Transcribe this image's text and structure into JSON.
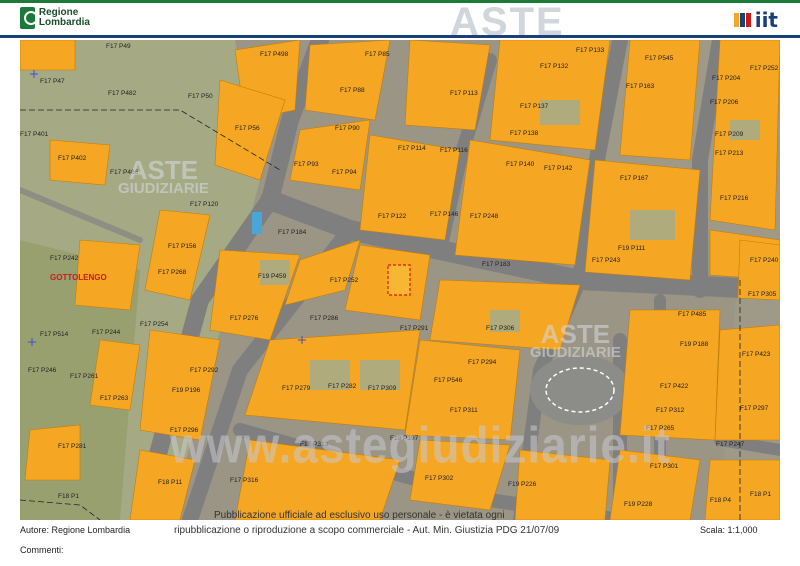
{
  "header": {
    "logo_text_line1": "Regione",
    "logo_text_line2": "Lombardia",
    "partner_logo_text": "iit",
    "watermark_aste": "ASTE",
    "watermark_giudiziarie": "GIUDIZIARIE"
  },
  "map": {
    "place_name": "GOTTOLENGO",
    "watermark_url": "www.astegiudiziarie.it",
    "watermark_overlay": "Pubblicazione ufficiale ad esclusivo uso personale - è vietata ogni",
    "parcels": [
      "F17 P49",
      "F17 P498",
      "F17 P85",
      "F17 P133",
      "F17 P545",
      "F17 P252",
      "F17 P47",
      "F17 P88",
      "F17 P132",
      "F17 P163",
      "F17 P204",
      "F17 P482",
      "F17 P50",
      "F17 P113",
      "F17 P137",
      "F17 P206",
      "F17 P90",
      "F17 P56",
      "F17 P138",
      "F17 P209",
      "F17 P401",
      "F17 P114",
      "F17 P116",
      "F17 P213",
      "F17 P402",
      "F17 P93",
      "F17 P140",
      "F17 P142",
      "F17 P94",
      "F17 P167",
      "F17 P216",
      "F17 P486",
      "F17 P120",
      "F17 P122",
      "F17 P146",
      "F17 P248",
      "F17 P184",
      "F19 P111",
      "F17 P240",
      "F17 P242",
      "F17 P156",
      "F17 P183",
      "F17 P243",
      "F17 P268",
      "F17 P252",
      "F19 P459",
      "F17 P305",
      "F17 P485",
      "F17 P514",
      "F17 P244",
      "F17 P254",
      "F17 P276",
      "F17 P286",
      "F17 P291",
      "F17 P306",
      "F19 P188",
      "F17 P423",
      "F17 P246",
      "F17 P261",
      "F17 P292",
      "F17 P294",
      "F17 P546",
      "F17 P279",
      "F17 P282",
      "F17 P309",
      "F17 P422",
      "F17 P263",
      "F19 P196",
      "F17 P297",
      "F17 P311",
      "F17 P312",
      "F17 P265",
      "F17 P296",
      "F19 P197",
      "F17 P247",
      "F17 P281",
      "F17 P313",
      "F17 P301",
      "F17 P302",
      "F19 P226",
      "F18 P4",
      "F18 P11",
      "F17 P316",
      "F19 P228",
      "F18 P1"
    ]
  },
  "footer": {
    "author": "Autore: Regione Lombardia",
    "notice": "ripubblicazione o riproduzione a scopo commerciale - Aut. Min. Giustizia PDG 21/07/09",
    "scale": "Scala: 1:1,000",
    "comments": "Commenti:"
  },
  "colors": {
    "building": "#f5a623",
    "road": "#8a8a8a",
    "green": "#a7ad84",
    "header_green": "#1b7a3a",
    "header_blue": "#1a3f7a"
  }
}
